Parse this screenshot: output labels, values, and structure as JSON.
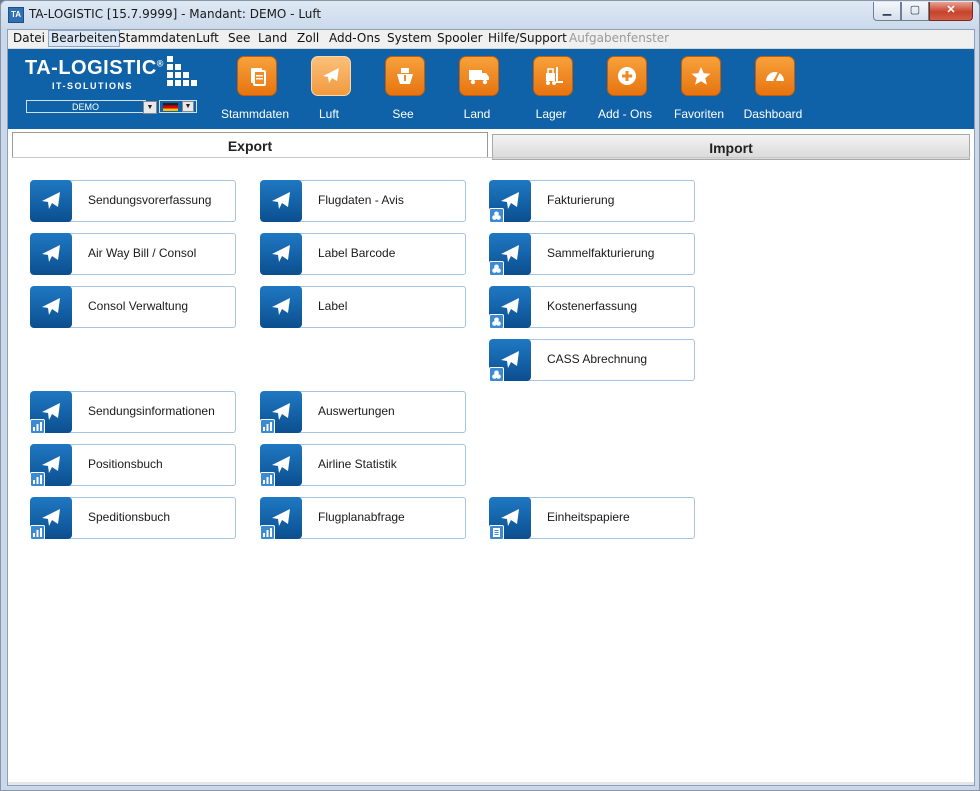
{
  "window": {
    "app_icon": "TA",
    "title": "TA-LOGISTIC [15.7.9999] - Mandant: DEMO - Luft",
    "controls": {
      "minimize": "▁",
      "maximize": "▢",
      "close": "✕"
    }
  },
  "menubar": {
    "items": [
      "Datei",
      "Bearbeiten",
      "Stammdaten",
      "Luft",
      "See",
      "Land",
      "Zoll",
      "Add-Ons",
      "System",
      "Spooler",
      "Hilfe/Support",
      "Aufgabenfenster"
    ]
  },
  "logo": {
    "title": "TA-LOGISTIC",
    "reg": "®",
    "subtitle": "IT-SOLUTIONS",
    "mandant": "DEMO"
  },
  "toolbar": {
    "items": [
      {
        "label": "Stammdaten",
        "icon": "document-stack-icon"
      },
      {
        "label": "Luft",
        "icon": "airplane-icon",
        "selected": true
      },
      {
        "label": "See",
        "icon": "ship-icon"
      },
      {
        "label": "Land",
        "icon": "truck-icon"
      },
      {
        "label": "Lager",
        "icon": "forklift-icon"
      },
      {
        "label": "Add - Ons",
        "icon": "plus-circle-icon"
      },
      {
        "label": "Favoriten",
        "icon": "star-icon"
      },
      {
        "label": "Dashboard",
        "icon": "gauge-icon"
      }
    ],
    "accent": "#f08a24",
    "background": "#0f62a8"
  },
  "tabs": {
    "export": "Export",
    "import": "Import",
    "active": "Export"
  },
  "tiles": {
    "col1": [
      "Sendungsvorerfassung",
      "Air Way Bill / Consol",
      "Consol Verwaltung"
    ],
    "col2": [
      "Flugdaten - Avis",
      "Label Barcode",
      "Label"
    ],
    "col3": [
      "Fakturierung",
      "Sammelfakturierung",
      "Kostenerfassung",
      "CASS Abrechnung"
    ],
    "report_col1": [
      "Sendungsinformationen",
      "Positionsbuch",
      "Speditionsbuch"
    ],
    "report_col2": [
      "Auswertungen",
      "Airline Statistik",
      "Flugplanabfrage"
    ],
    "report_col3": [
      "Einheitspapiere"
    ]
  }
}
